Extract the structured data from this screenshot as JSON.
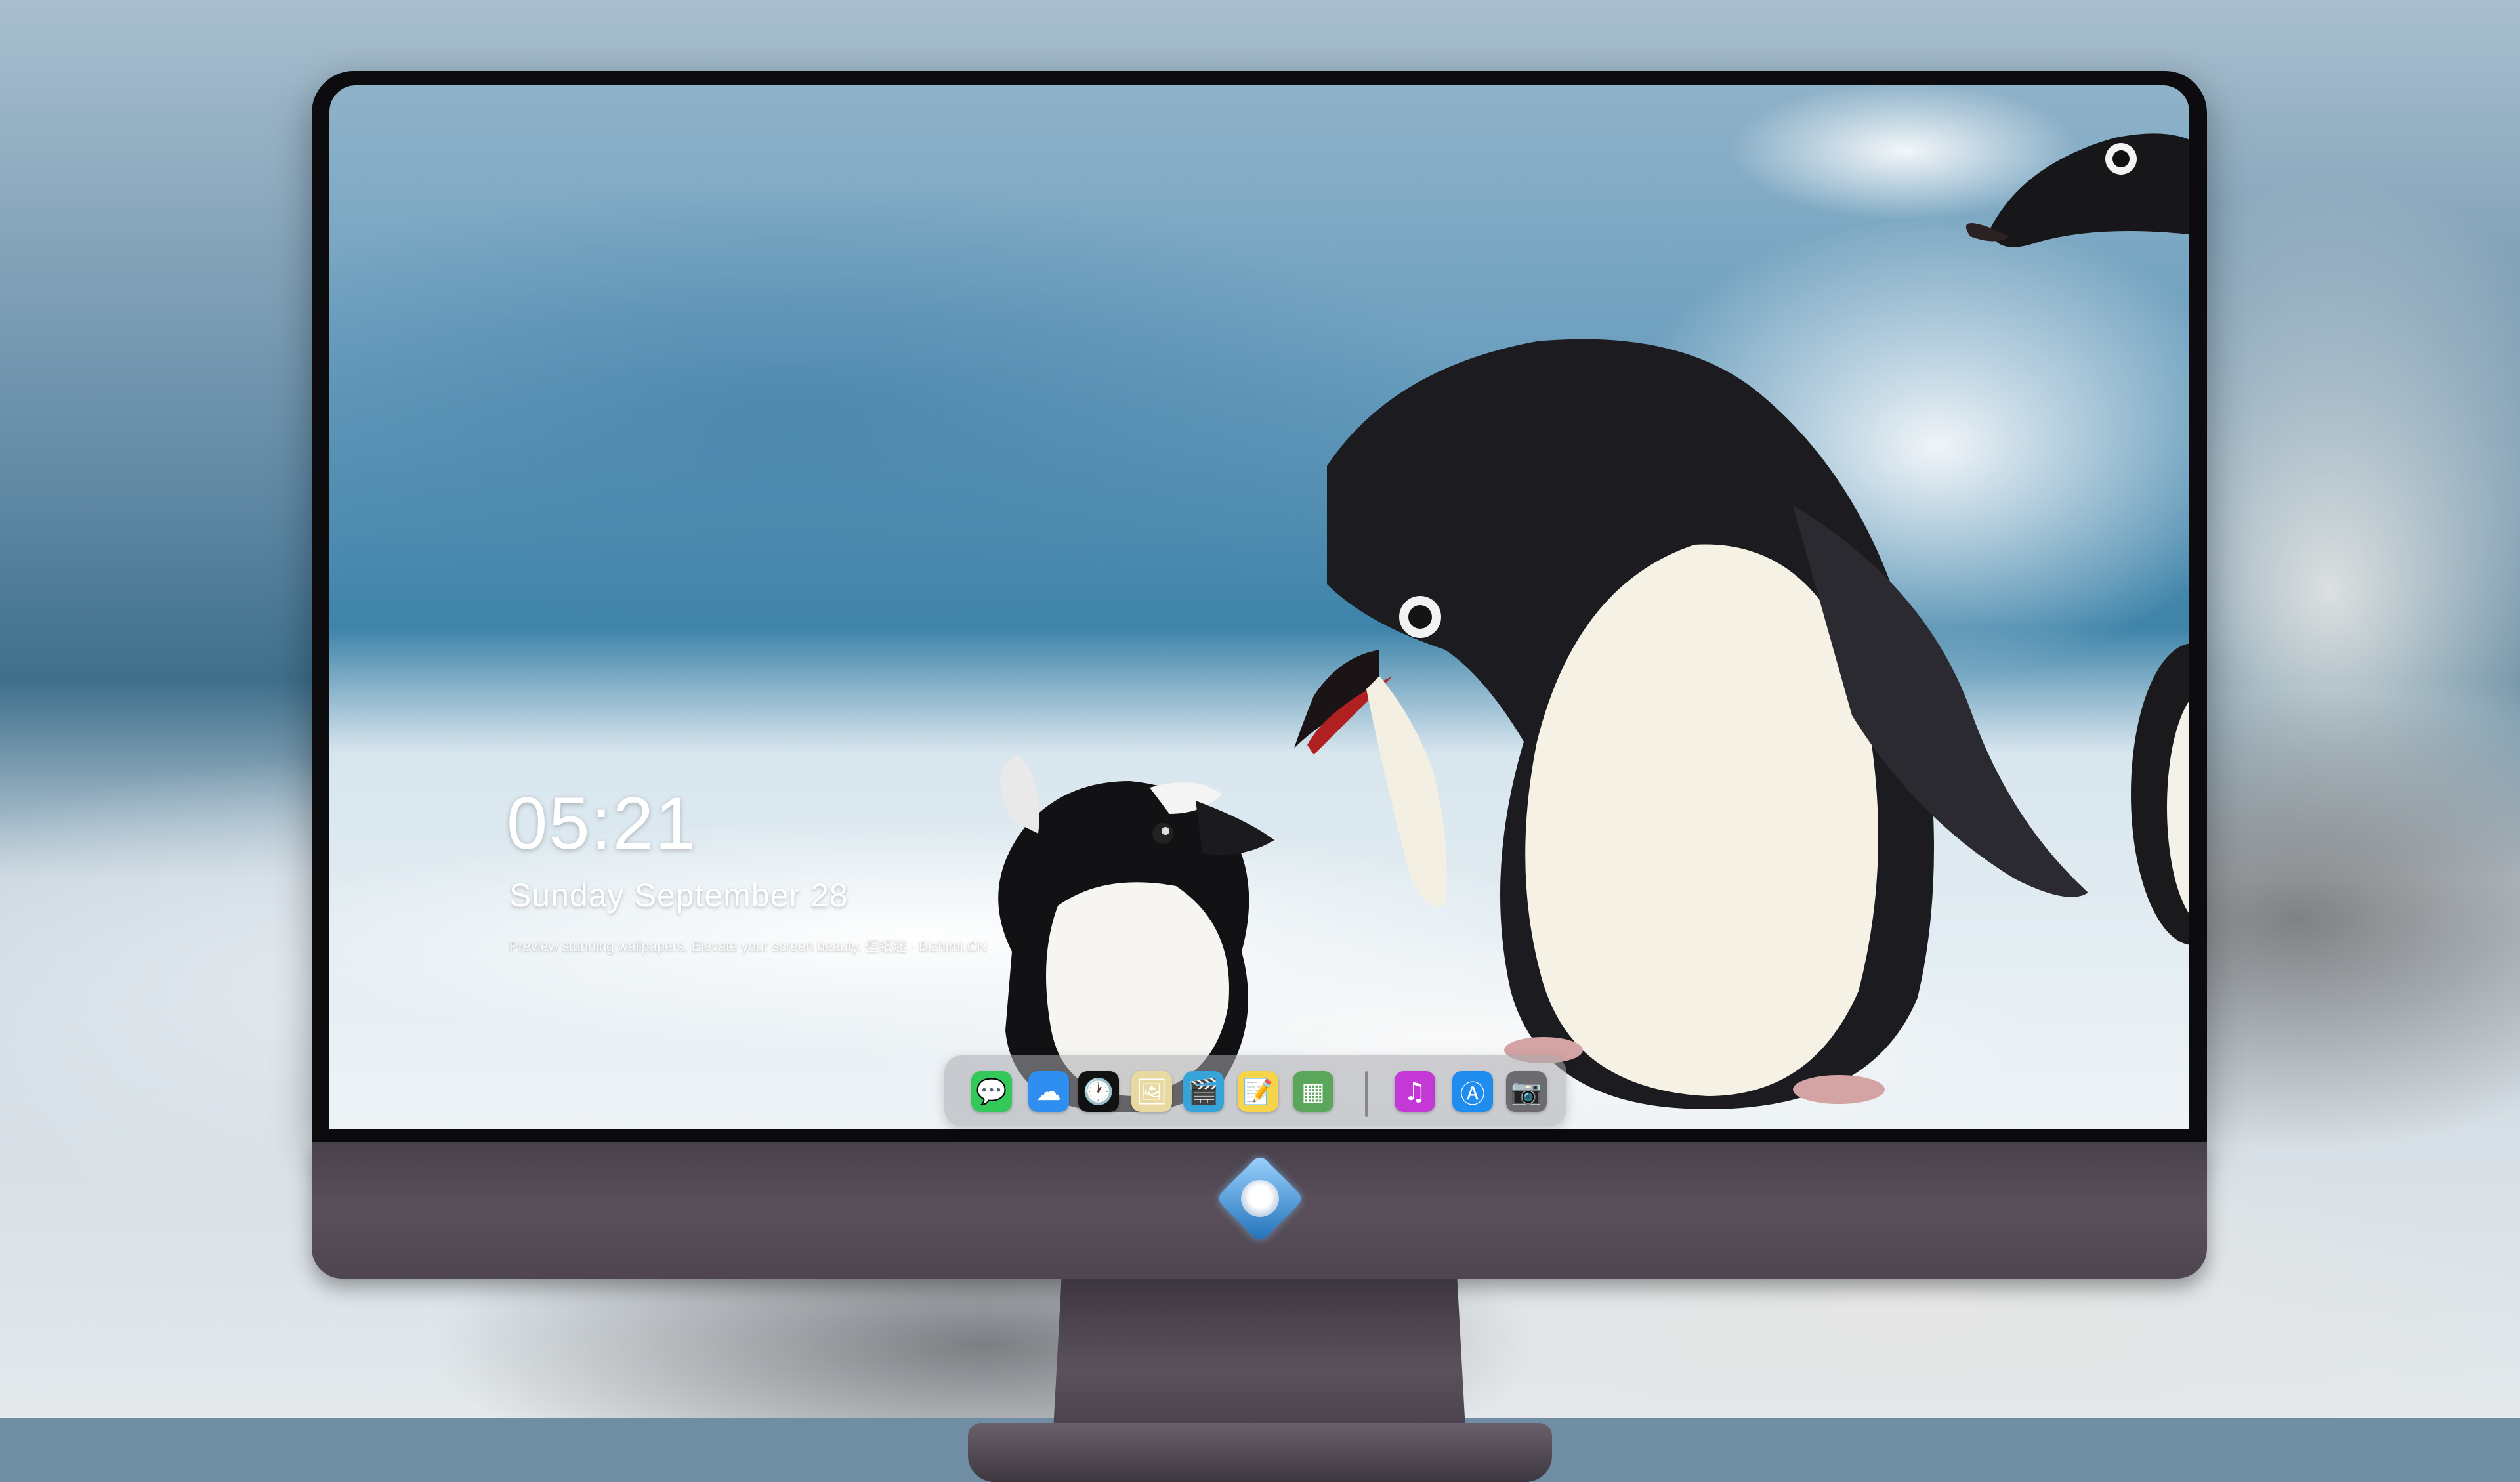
{
  "lock_screen": {
    "time": "05:21",
    "date": "Sunday September  28",
    "tagline": "Preview stunning wallpapers. Elevate your screen beauty. 壁纸迷 · Bizhimi.CN"
  },
  "dock": {
    "apps": [
      {
        "name": "messages-icon",
        "glyph": "💬",
        "color": "#34c759"
      },
      {
        "name": "weather-icon",
        "glyph": "☁",
        "color": "#2f8ff0"
      },
      {
        "name": "clock-icon",
        "glyph": "🕐",
        "color": "#111111"
      },
      {
        "name": "preview-icon",
        "glyph": "🖼",
        "color": "#e8d9a0"
      },
      {
        "name": "claquette-icon",
        "glyph": "🎬",
        "color": "#36a3d9"
      },
      {
        "name": "notes-icon",
        "glyph": "📝",
        "color": "#f7d54a"
      },
      {
        "name": "photo-booth-icon",
        "glyph": "▦",
        "color": "#5aa65a"
      },
      {
        "name": "itunes-icon",
        "glyph": "♫",
        "color": "#c438d6"
      },
      {
        "name": "app-store-icon",
        "glyph": "Ⓐ",
        "color": "#1f8cf0"
      },
      {
        "name": "camera-icon",
        "glyph": "📷",
        "color": "#6b6b70"
      }
    ]
  },
  "colors": {
    "bezel": "#0c0c0e",
    "chin": "#4e4550",
    "clock_text": "#ffffff"
  }
}
